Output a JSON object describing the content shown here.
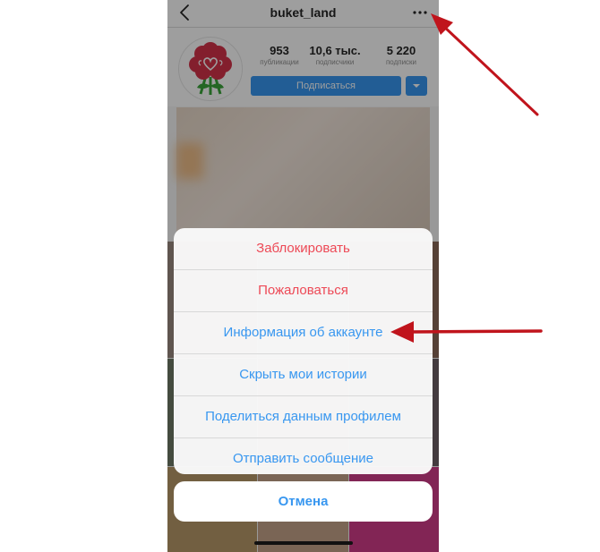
{
  "header": {
    "username": "buket_land",
    "back_icon": "chevron-left-icon",
    "more_icon": "more-horizontal-icon"
  },
  "profile": {
    "stats": [
      {
        "value": "953",
        "label": "публикации"
      },
      {
        "value": "10,6 тыс.",
        "label": "подписчики"
      },
      {
        "value": "5 220",
        "label": "подписки"
      }
    ],
    "follow_label": "Подписаться",
    "avatar_icon": "flower-bouquet-logo"
  },
  "action_sheet": {
    "items": [
      {
        "label": "Заблокировать",
        "style": "destructive"
      },
      {
        "label": "Пожаловаться",
        "style": "destructive"
      },
      {
        "label": "Информация об аккаунте",
        "style": "default"
      },
      {
        "label": "Скрыть мои истории",
        "style": "default"
      },
      {
        "label": "Поделиться данным профилем",
        "style": "default"
      },
      {
        "label": "Отправить сообщение",
        "style": "default"
      }
    ],
    "cancel_label": "Отмена"
  },
  "colors": {
    "accent": "#3897f0",
    "destructive": "#ed4956",
    "annotation_arrow": "#c0141c"
  }
}
